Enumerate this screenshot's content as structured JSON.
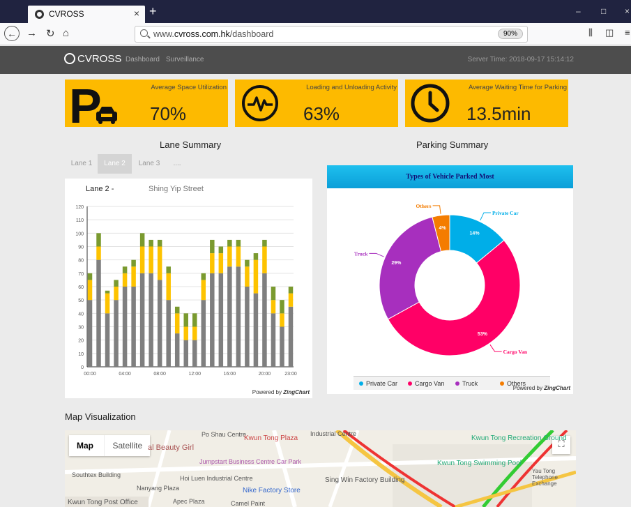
{
  "browser": {
    "tab_title": "CVROSS",
    "tab_close": "×",
    "new_tab": "+",
    "url_prefix": "www.",
    "url_domain": "cvross.com.hk",
    "url_path": "/dashboard",
    "zoom": "90%",
    "win_minimize": "–",
    "win_maximize": "□",
    "win_close": "×"
  },
  "header": {
    "logo": "CVROSS",
    "nav_dashboard": "Dashboard",
    "nav_surveillance": "Surveillance",
    "server_time": "Server Time: 2018-09-17 15:14:12"
  },
  "kpis": [
    {
      "label": "Average Space Utilization",
      "value": "70%",
      "icon": "parking-car-icon"
    },
    {
      "label": "Loading and Unloading Activity",
      "value": "63%",
      "icon": "activity-pulse-icon"
    },
    {
      "label": "Average Waiting Time for Parking",
      "value": "13.5min",
      "icon": "clock-icon"
    }
  ],
  "lane_summary": {
    "title": "Lane Summary",
    "tabs": [
      "Lane 1",
      "Lane 2",
      "Lane 3",
      "...."
    ],
    "active_tab": 1,
    "chart_title_lane": "Lane 2 -",
    "chart_title_street": "Shing Yip Street",
    "powered_by": "Powered by",
    "powered_brand": "ZingChart"
  },
  "parking_summary": {
    "title": "Parking Summary",
    "chart_title": "Types of Vehicle Parked Most",
    "powered_by": "Powered by",
    "powered_brand": "ZingChart"
  },
  "map": {
    "title": "Map Visualization",
    "btn_map": "Map",
    "btn_satellite": "Satellite",
    "labels": [
      "Po Shau Centre",
      "Kwun Tong Plaza",
      "Industrial Centre",
      "Kwun Tong Recreation Ground",
      "al Beauty Girl",
      "Jumpstart Business Centre Car Park",
      "Kwun Tong Swimming Pool",
      "Southtex Building",
      "Hoi Luen Industrial Centre",
      "Nanyang Plaza",
      "Nike Factory Store",
      "Sing Win Factory Building",
      "Yau Tong Telephone Exchange",
      "Kwun Tong Post Office",
      "Apec Plaza",
      "Camel Paint"
    ]
  },
  "colors": {
    "kpi_bg": "#fdba00",
    "header_bg": "#4d4d4d",
    "bar_base": "#7f7f7f",
    "bar_mid": "#fdc300",
    "bar_top": "#7a9a2f",
    "private_car": "#00aee8",
    "cargo_van": "#ff0066",
    "truck": "#a72fbe",
    "others": "#f47c00"
  },
  "chart_data": [
    {
      "type": "bar",
      "stacked": true,
      "title": "Lane 2 - Shing Yip Street",
      "categories": [
        "00:00",
        "01:00",
        "02:00",
        "03:00",
        "04:00",
        "05:00",
        "06:00",
        "07:00",
        "08:00",
        "09:00",
        "10:00",
        "11:00",
        "12:00",
        "13:00",
        "14:00",
        "15:00",
        "16:00",
        "17:00",
        "18:00",
        "19:00",
        "20:00",
        "21:00",
        "22:00",
        "23:00"
      ],
      "xticks": [
        "00:00",
        "04:00",
        "08:00",
        "12:00",
        "16:00",
        "20:00",
        "23:00"
      ],
      "bottom": [
        50,
        80,
        40,
        50,
        60,
        60,
        70,
        70,
        65,
        50,
        25,
        20,
        20,
        50,
        70,
        70,
        75,
        75,
        60,
        55,
        70,
        40,
        30,
        45
      ],
      "middle": [
        15,
        10,
        15,
        10,
        10,
        15,
        20,
        20,
        25,
        20,
        15,
        10,
        10,
        15,
        15,
        15,
        15,
        15,
        15,
        25,
        20,
        10,
        10,
        10
      ],
      "top": [
        5,
        10,
        2,
        5,
        5,
        5,
        10,
        5,
        5,
        5,
        5,
        10,
        10,
        5,
        10,
        5,
        5,
        5,
        5,
        5,
        5,
        10,
        10,
        5
      ],
      "ylim": [
        0,
        120
      ],
      "yticks": [
        0,
        10,
        20,
        30,
        40,
        50,
        60,
        70,
        80,
        90,
        100,
        110,
        120
      ]
    },
    {
      "type": "pie",
      "donut": true,
      "title": "Types of Vehicle Parked Most",
      "labels": [
        "Private Car",
        "Cargo Van",
        "Truck",
        "Others"
      ],
      "values": [
        14,
        53,
        29,
        4
      ],
      "legend": [
        "Private Car",
        "Cargo Van",
        "Truck",
        "Others"
      ],
      "legend_position": "bottom"
    }
  ]
}
